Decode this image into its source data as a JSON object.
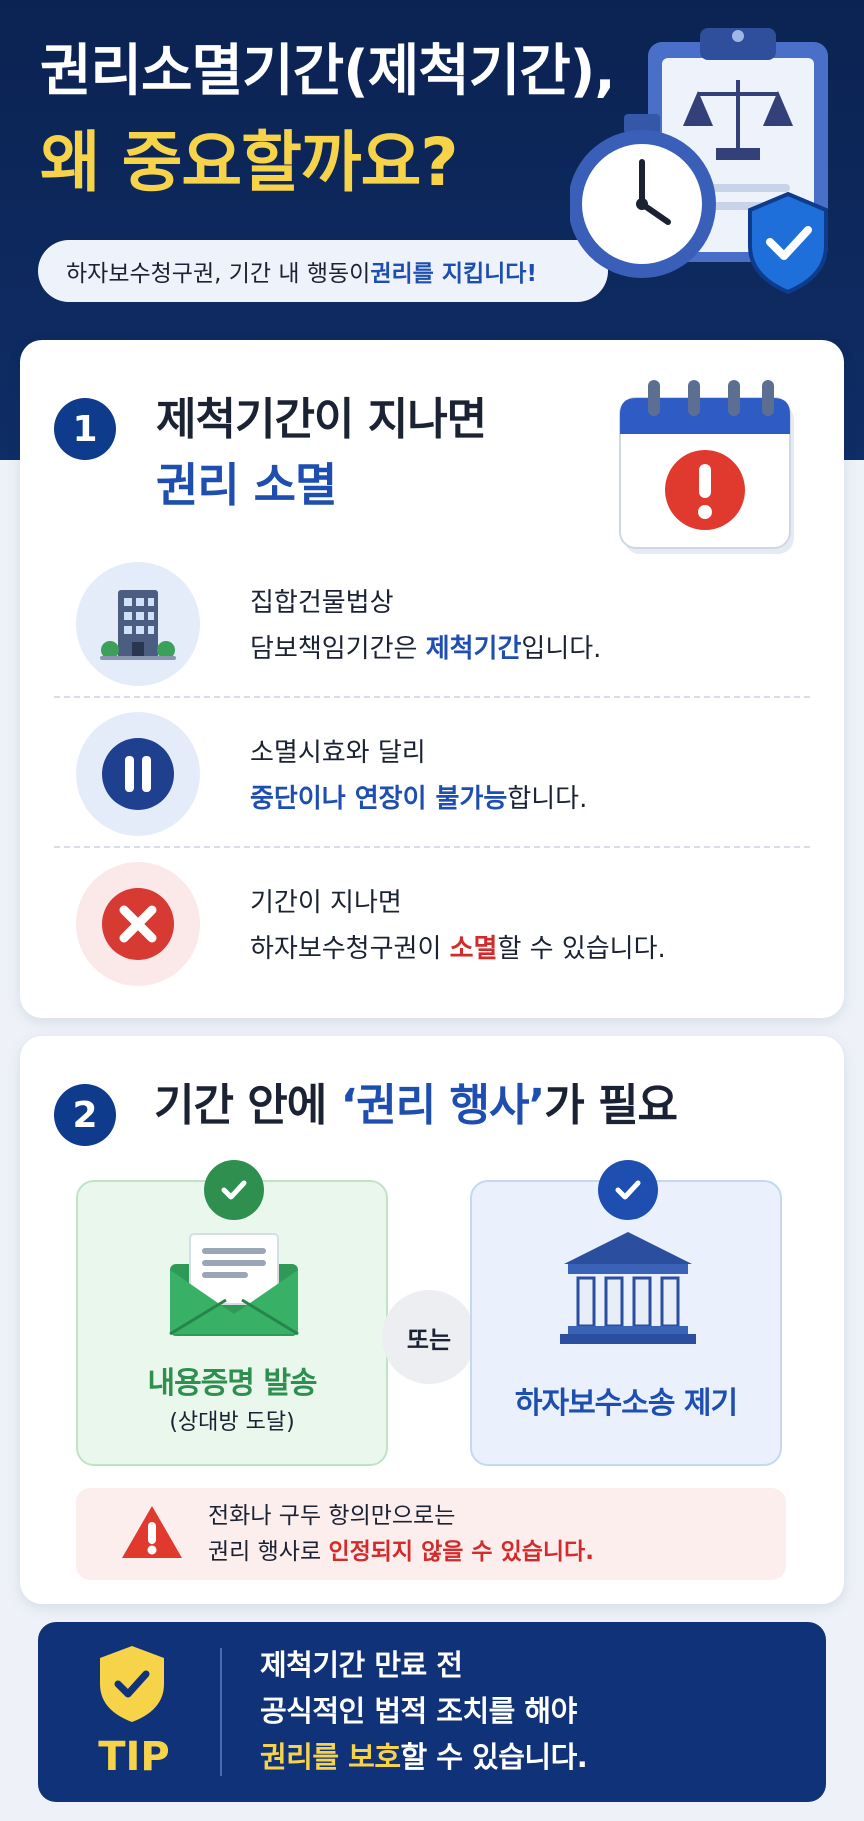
{
  "hero": {
    "title_line1": "권리소멸기간(제척기간),",
    "title_line2": "왜 중요할까요?",
    "pill_text_prefix": "하자보수청구권, 기간 내 행동이 ",
    "pill_text_highlight": "권리를 지킵니다!",
    "icons": [
      "clipboard-icon",
      "scales-icon",
      "stopwatch-icon",
      "shield-check-icon"
    ]
  },
  "section1": {
    "number": "1",
    "title_line1": "제척기간이 지나면",
    "title_line2": "권리 소멸",
    "icon": "calendar-alert-icon",
    "items": [
      {
        "icon": "building-icon",
        "line1": "집합건물법상",
        "line2_prefix": "담보책임기간은 ",
        "line2_highlight": "제척기간",
        "line2_suffix": "입니다."
      },
      {
        "icon": "pause-icon",
        "line1": "소멸시효와 달리",
        "line2_highlight": "중단이나 연장이 불가능",
        "line2_suffix": "합니다."
      },
      {
        "icon": "x-circle-icon",
        "line1": "기간이 지나면",
        "line2_prefix": "하자보수청구권이 ",
        "line2_highlight": "소멸",
        "line2_suffix": "할 수 있습니다."
      }
    ]
  },
  "section2": {
    "number": "2",
    "title_prefix": "기간 안에 ",
    "title_highlight": "‘권리 행사’",
    "title_suffix": "가 필요",
    "option_left": {
      "label": "내용증명 발송",
      "sub": "(상대방 도달)",
      "icon": "envelope-icon"
    },
    "or_label": "또는",
    "option_right": {
      "label": "하자보수소송 제기",
      "icon": "courthouse-icon"
    },
    "warning": {
      "line1": "전화나 구두 항의만으로는",
      "line2_prefix": "권리 행사로 ",
      "line2_highlight": "인정되지 않을 수 있습니다."
    }
  },
  "tip": {
    "label": "TIP",
    "line1": "제척기간 만료 전",
    "line2": "공식적인 법적 조치를 해야",
    "line3_highlight": "권리를 보호",
    "line3_suffix": "할 수 있습니다."
  },
  "colors": {
    "navy": "#0f2d66",
    "yellow": "#f7d34a",
    "blue": "#1e4fb0",
    "red": "#d32b2b",
    "green": "#2f8f4e"
  }
}
